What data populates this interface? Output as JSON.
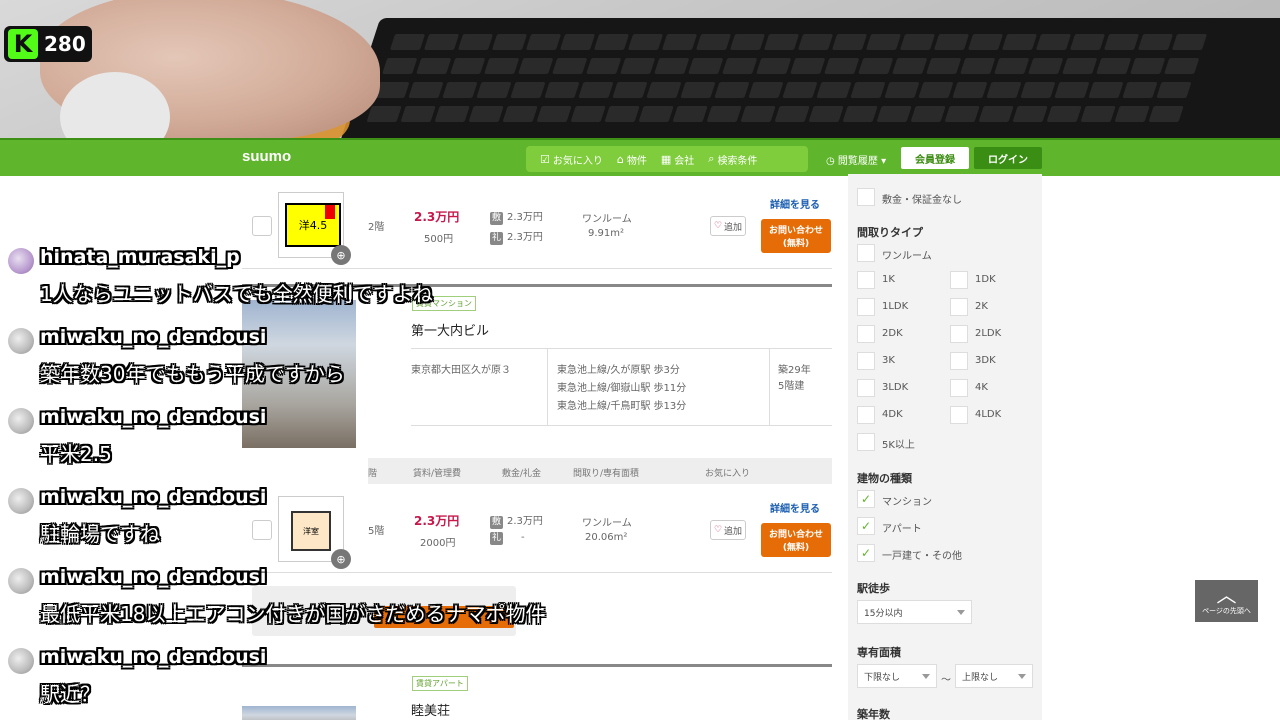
{
  "stream": {
    "viewer_count": "280",
    "logo_letter": "K"
  },
  "site": {
    "logo": "suumo",
    "nav": [
      {
        "label": "お気に入り",
        "icon": "checkbox-icon"
      },
      {
        "label": "物件",
        "icon": "house-icon"
      },
      {
        "label": "会社",
        "icon": "building-icon"
      },
      {
        "label": "検索条件",
        "icon": "search-icon"
      }
    ],
    "history": "閲覧履歴",
    "register": "会員登録",
    "login": "ログイン"
  },
  "listings": {
    "row1": {
      "floor": "2階",
      "thumb_text": "洋4.5",
      "rent": "2.3万円",
      "fee": "500円",
      "deposit": "2.3万円",
      "key_money": "2.3万円",
      "layout": "ワンルーム",
      "area": "9.91m²",
      "fav": "追加",
      "contact1": "お問い合わせ",
      "contact2": "(無料)",
      "detail": "詳細を見る",
      "deposit_label": "敷",
      "key_label": "礼"
    },
    "building1": {
      "tag": "賃貸マンション",
      "name": "第一大内ビル",
      "address": "東京都大田区久が原３",
      "station1": "東急池上線/久が原駅 歩3分",
      "station2": "東急池上線/御嶽山駅 歩11分",
      "station3": "東急池上線/千鳥町駅 歩13分",
      "age": "築29年",
      "floors": "5階建"
    },
    "header": {
      "floor": "階",
      "rent": "賃料/管理費",
      "deposit": "敷金/礼金",
      "layout": "間取り/専有面積",
      "fav": "お気に入り"
    },
    "row2": {
      "floor": "5階",
      "thumb_text": "洋室",
      "rent": "2.3万円",
      "fee": "2000円",
      "deposit": "2.3万円",
      "key_money": "-",
      "layout": "ワンルーム",
      "area": "20.06m²",
      "fav": "追加",
      "contact1": "お問い合わせ",
      "contact2": "(無料)",
      "detail": "詳細を見る",
      "deposit_label": "敷",
      "key_label": "礼"
    },
    "building2": {
      "tag": "賃貸アパート",
      "name": "睦美荘"
    }
  },
  "sidebar": {
    "top_option": "敷金・保証金なし",
    "layout_title": "間取りタイプ",
    "layouts": [
      "ワンルーム",
      "1K",
      "1DK",
      "1LDK",
      "2K",
      "2DK",
      "2LDK",
      "3K",
      "3DK",
      "3LDK",
      "4K",
      "4DK",
      "4LDK",
      "5K以上"
    ],
    "type_title": "建物の種類",
    "types": [
      "マンション",
      "アパート",
      "一戸建て・その他"
    ],
    "walk_title": "駅徒歩",
    "walk_value": "15分以内",
    "area_title": "専有面積",
    "area_min": "下限なし",
    "area_sep": "〜",
    "area_max": "上限なし",
    "age_title": "築年数"
  },
  "pagetop": "ページの先頭へ",
  "chat": [
    {
      "user": "hinata_murasaki_p",
      "text": "1人ならユニットバスでも全然便利ですよね"
    },
    {
      "user": "miwaku_no_dendousi",
      "text": "築年数30年でももう平成ですから"
    },
    {
      "user": "miwaku_no_dendousi",
      "text": "平米2.5"
    },
    {
      "user": "miwaku_no_dendousi",
      "text": "駐輪場ですね"
    },
    {
      "user": "miwaku_no_dendousi",
      "text": "最低平米18以上エアコン付きが国がさだめるナマポ物件"
    },
    {
      "user": "miwaku_no_dendousi",
      "text": "駅近？"
    }
  ]
}
